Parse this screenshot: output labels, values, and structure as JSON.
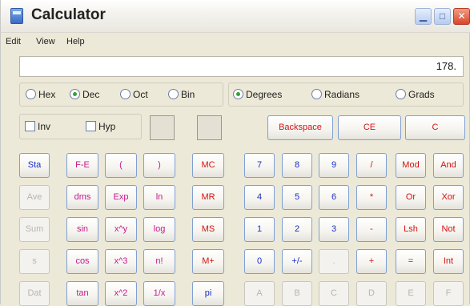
{
  "window": {
    "title": "Calculator"
  },
  "menu": {
    "items": [
      "Edit",
      "View",
      "Help"
    ]
  },
  "display": {
    "value": "178."
  },
  "number_system": {
    "options": [
      "Hex",
      "Dec",
      "Oct",
      "Bin"
    ],
    "selected": "Dec"
  },
  "angle_units": {
    "options": [
      "Degrees",
      "Radians",
      "Grads"
    ],
    "selected": "Degrees"
  },
  "modifiers": {
    "inv": "Inv",
    "hyp": "Hyp"
  },
  "buttons": {
    "backspace": "Backspace",
    "ce": "CE",
    "c": "C",
    "sta": "Sta",
    "ave": "Ave",
    "sum": "Sum",
    "s": "s",
    "dat": "Dat",
    "fe": "F-E",
    "lparen": "(",
    "rparen": ")",
    "dms": "dms",
    "exp": "Exp",
    "ln": "ln",
    "sin": "sin",
    "xy": "x^y",
    "log": "log",
    "cos": "cos",
    "x3": "x^3",
    "nfact": "n!",
    "tan": "tan",
    "x2": "x^2",
    "recip": "1/x",
    "mc": "MC",
    "mr": "MR",
    "ms": "MS",
    "mplus": "M+",
    "pi": "pi",
    "n7": "7",
    "n8": "8",
    "n9": "9",
    "div": "/",
    "mod": "Mod",
    "and": "And",
    "n4": "4",
    "n5": "5",
    "n6": "6",
    "mul": "*",
    "or": "Or",
    "xor": "Xor",
    "n1": "1",
    "n2": "2",
    "n3": "3",
    "sub": "-",
    "lsh": "Lsh",
    "not": "Not",
    "n0": "0",
    "sign": "+/-",
    "dot": ".",
    "add": "+",
    "eq": "=",
    "int": "Int",
    "hA": "A",
    "hB": "B",
    "hC": "C",
    "hD": "D",
    "hE": "E",
    "hF": "F"
  },
  "colors": {
    "accent_blue": "#1c2fc4",
    "accent_red": "#d41313",
    "accent_pink": "#c9188f",
    "button_border": "#7f9fd3"
  }
}
